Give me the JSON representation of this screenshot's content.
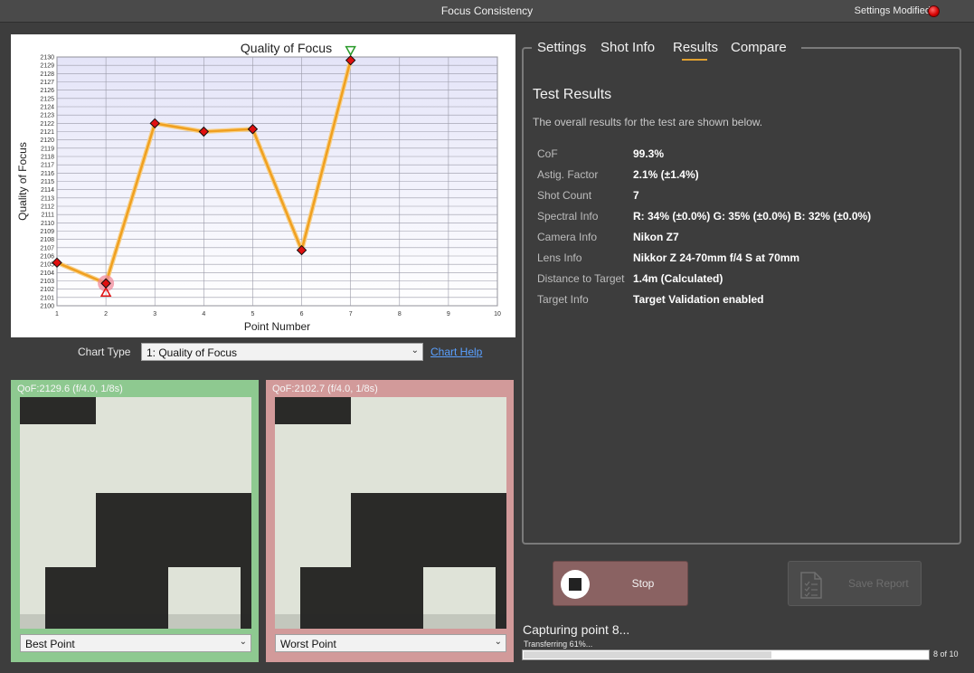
{
  "window": {
    "title": "Focus Consistency",
    "status_text": "Settings Modified",
    "status_color": "#e00000"
  },
  "chart_data": {
    "type": "line",
    "title": "Quality of Focus",
    "xlabel": "Point Number",
    "ylabel": "Quality of Focus",
    "x": [
      1,
      2,
      3,
      4,
      5,
      6,
      7
    ],
    "values": [
      2105.2,
      2102.7,
      2122.0,
      2121.0,
      2121.3,
      2106.7,
      2129.6
    ],
    "xlim": [
      1,
      10
    ],
    "ylim": [
      2100,
      2130
    ],
    "x_ticks": [
      "1",
      "2",
      "3",
      "4",
      "5",
      "6",
      "7",
      "8",
      "9",
      "10"
    ],
    "y_ticks": [
      "2100",
      "2101",
      "2102",
      "2103",
      "2104",
      "2105",
      "2106",
      "2107",
      "2108",
      "2109",
      "2110",
      "2111",
      "2112",
      "2113",
      "2114",
      "2115",
      "2116",
      "2117",
      "2118",
      "2119",
      "2120",
      "2121",
      "2122",
      "2123",
      "2124",
      "2125",
      "2126",
      "2127",
      "2128",
      "2129",
      "2130"
    ],
    "best_point": 7,
    "worst_point": 2,
    "line_color": "#f0a020",
    "marker_color": "#e01010",
    "best_marker_color": "#2a9a2a",
    "worst_marker_color": "#e01010",
    "grid": true
  },
  "chart_controls": {
    "chart_type_label": "Chart Type",
    "chart_type_value": "1: Quality of Focus",
    "chart_help_label": "Chart Help"
  },
  "thumbnails": {
    "best": {
      "caption": "QoF:2129.6 (f/4.0, 1/8s)",
      "selector": "Best Point",
      "border_color": "#8ec990"
    },
    "worst": {
      "caption": "QoF:2102.7 (f/4.0, 1/8s)",
      "selector": "Worst Point",
      "border_color": "#d29a9a"
    }
  },
  "tabs": [
    {
      "label": "Settings"
    },
    {
      "label": "Shot Info"
    },
    {
      "label": "Results",
      "active": true
    },
    {
      "label": "Compare"
    }
  ],
  "results": {
    "title": "Test Results",
    "description": "The overall results for the test are shown below.",
    "rows": [
      {
        "key": "CoF",
        "value": "99.3%"
      },
      {
        "key": "Astig. Factor",
        "value": "2.1% (±1.4%)"
      },
      {
        "key": "Shot Count",
        "value": "7"
      },
      {
        "key": "Spectral Info",
        "value": "R: 34% (±0.0%) G: 35% (±0.0%) B: 32% (±0.0%)"
      },
      {
        "key": "Camera Info",
        "value": "Nikon Z7"
      },
      {
        "key": "Lens Info",
        "value": "Nikkor Z 24-70mm f/4 S at 70mm"
      },
      {
        "key": "Distance to Target",
        "value": "1.4m (Calculated)"
      },
      {
        "key": "Target Info",
        "value": "Target Validation enabled"
      }
    ]
  },
  "actions": {
    "stop_label": "Stop",
    "save_report_label": "Save Report"
  },
  "progress": {
    "capturing_text": "Capturing point 8...",
    "transferring_text": "Transferring 61%...",
    "fraction": 0.61,
    "count_text": "8 of 10"
  }
}
